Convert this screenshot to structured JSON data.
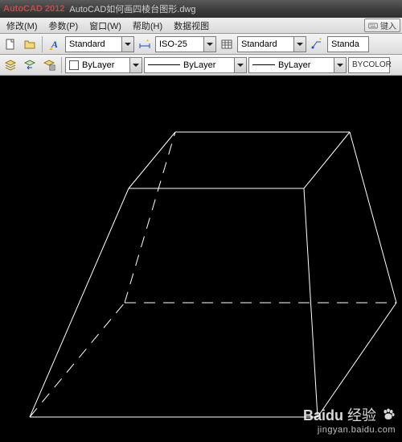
{
  "titlebar": {
    "appname": "AutoCAD 2012",
    "filename": "AutoCAD如何画四棱台图形.dwg"
  },
  "menubar": {
    "items": [
      {
        "label": "修改(M)"
      },
      {
        "label": "参数(P)"
      },
      {
        "label": "窗口(W)"
      },
      {
        "label": "帮助(H)"
      },
      {
        "label": "数据视图"
      }
    ],
    "key_input": "键入"
  },
  "toolbar1": {
    "text_style": "Standard",
    "dim_style": "ISO-25",
    "table_style": "Standard",
    "mleader_style": "Standa"
  },
  "toolbar2": {
    "color": "ByLayer",
    "linetype": "ByLayer",
    "lineweight": "ByLayer",
    "plot_style": "BYCOLOR"
  },
  "watermark": {
    "brand": "Baidu",
    "brand_cn": "经验",
    "url": "jingyan.baidu.com"
  }
}
